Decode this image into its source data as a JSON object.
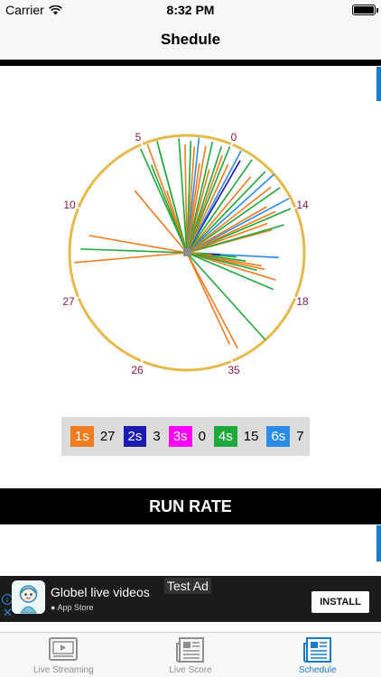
{
  "status_bar": {
    "carrier": "Carrier",
    "time": "8:32 PM"
  },
  "nav": {
    "title": "Shedule"
  },
  "wagon_wheel": {
    "field_labels": [
      "5",
      "0",
      "10",
      "14",
      "27",
      "18",
      "26",
      "35"
    ],
    "legend": [
      {
        "label": "1s",
        "count": "27",
        "color": "#ef7d1f"
      },
      {
        "label": "2s",
        "count": "3",
        "color": "#1b1bb0"
      },
      {
        "label": "3s",
        "count": "0",
        "color": "#ff00ff"
      },
      {
        "label": "4s",
        "count": "15",
        "color": "#1fa83c"
      },
      {
        "label": "6s",
        "count": "7",
        "color": "#2b8ce6"
      }
    ]
  },
  "run_rate": {
    "title": "RUN RATE"
  },
  "ad": {
    "badge": "Test Ad",
    "title": "Globel live videos",
    "store": "App Store",
    "install": "INSTALL"
  },
  "tabs": [
    {
      "label": "Live Streaming",
      "active": false
    },
    {
      "label": "Live Score",
      "active": false
    },
    {
      "label": "Schedule",
      "active": true
    }
  ]
}
